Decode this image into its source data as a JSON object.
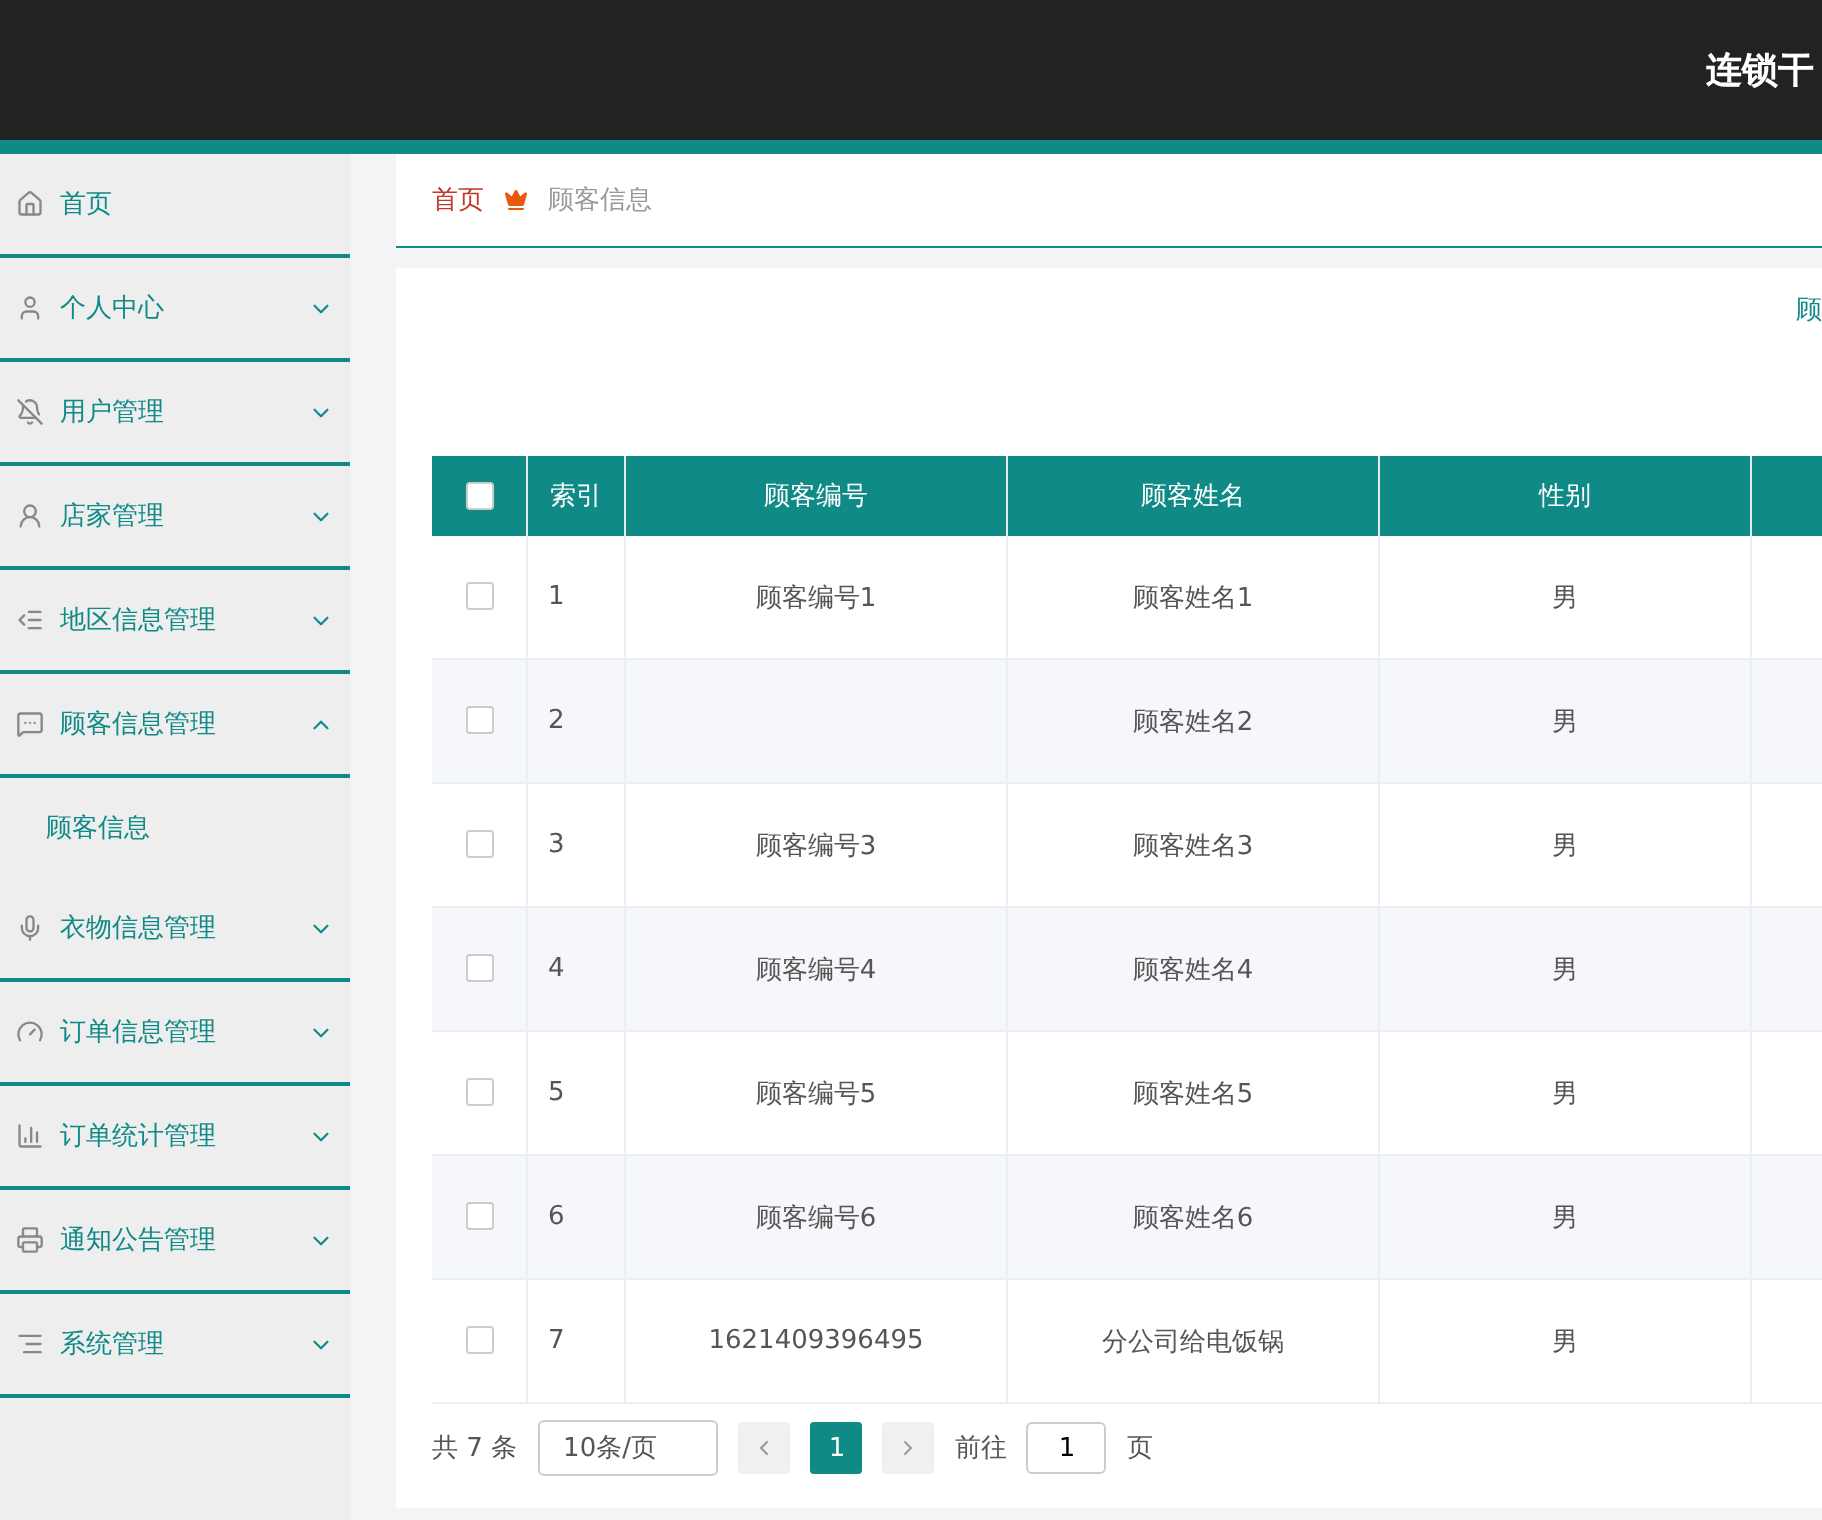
{
  "header": {
    "title": "连锁干"
  },
  "sidebar": {
    "items": [
      {
        "label": "首页",
        "kind": "link"
      },
      {
        "label": "个人中心",
        "kind": "group",
        "expanded": false
      },
      {
        "label": "用户管理",
        "kind": "group",
        "expanded": false
      },
      {
        "label": "店家管理",
        "kind": "group",
        "expanded": false
      },
      {
        "label": "地区信息管理",
        "kind": "group",
        "expanded": false
      },
      {
        "label": "顾客信息管理",
        "kind": "group",
        "expanded": true,
        "children": [
          {
            "label": "顾客信息"
          }
        ]
      },
      {
        "label": "衣物信息管理",
        "kind": "group",
        "expanded": false
      },
      {
        "label": "订单信息管理",
        "kind": "group",
        "expanded": false
      },
      {
        "label": "订单统计管理",
        "kind": "group",
        "expanded": false
      },
      {
        "label": "通知公告管理",
        "kind": "group",
        "expanded": false
      },
      {
        "label": "系统管理",
        "kind": "group",
        "expanded": false
      }
    ]
  },
  "breadcrumb": {
    "home": "首页",
    "current": "顾客信息"
  },
  "search": {
    "label": "顾"
  },
  "table": {
    "header_checked": false,
    "columns": [
      "索引",
      "顾客编号",
      "顾客姓名",
      "性别"
    ],
    "rows": [
      {
        "checked": false,
        "cells": [
          "1",
          "顾客编号1",
          "顾客姓名1",
          "男"
        ]
      },
      {
        "checked": false,
        "cells": [
          "2",
          "",
          "顾客姓名2",
          "男"
        ]
      },
      {
        "checked": false,
        "cells": [
          "3",
          "顾客编号3",
          "顾客姓名3",
          "男"
        ]
      },
      {
        "checked": false,
        "cells": [
          "4",
          "顾客编号4",
          "顾客姓名4",
          "男"
        ]
      },
      {
        "checked": false,
        "cells": [
          "5",
          "顾客编号5",
          "顾客姓名5",
          "男"
        ]
      },
      {
        "checked": false,
        "cells": [
          "6",
          "顾客编号6",
          "顾客姓名6",
          "男"
        ]
      },
      {
        "checked": false,
        "cells": [
          "7",
          "1621409396495",
          "分公司给电饭锅",
          "男"
        ]
      }
    ]
  },
  "pagination": {
    "total": "共 7 条",
    "page_size": "10条/页",
    "pages": [
      {
        "label": "1",
        "selected": true
      }
    ],
    "goto_label": "前往",
    "goto_value": "1",
    "goto_suffix": "页"
  }
}
